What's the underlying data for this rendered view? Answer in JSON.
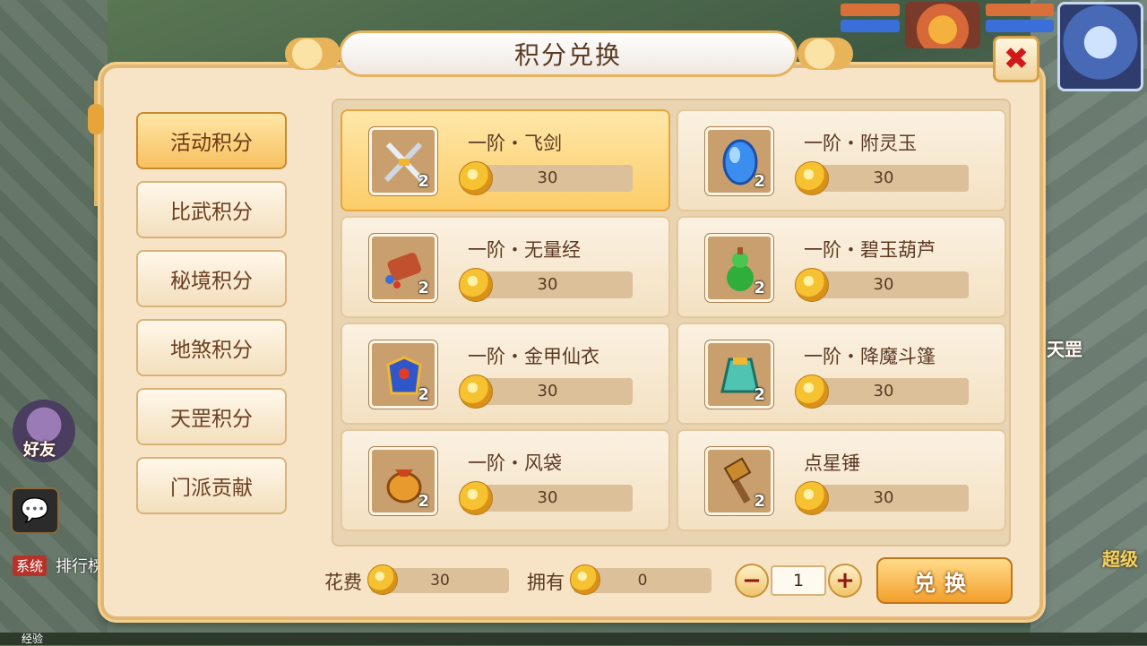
{
  "window": {
    "title": "积分兑换"
  },
  "background": {
    "friend_label": "好友",
    "system_tag": "系统",
    "rank_label": "排行榜",
    "exp_label": "经验",
    "right_text_1": "天罡",
    "right_text_2": "超级"
  },
  "tabs": [
    {
      "label": "活动积分",
      "active": true
    },
    {
      "label": "比武积分",
      "active": false
    },
    {
      "label": "秘境积分",
      "active": false
    },
    {
      "label": "地煞积分",
      "active": false
    },
    {
      "label": "天罡积分",
      "active": false
    },
    {
      "label": "门派贡献",
      "active": false
    }
  ],
  "items": [
    {
      "name": "一阶・飞剑",
      "count": "2",
      "price": "30",
      "icon": "sword-icon",
      "selected": true
    },
    {
      "name": "一阶・附灵玉",
      "count": "2",
      "price": "30",
      "icon": "jade-gem-icon",
      "selected": false
    },
    {
      "name": "一阶・无量经",
      "count": "2",
      "price": "30",
      "icon": "scroll-icon",
      "selected": false
    },
    {
      "name": "一阶・碧玉葫芦",
      "count": "2",
      "price": "30",
      "icon": "gourd-icon",
      "selected": false
    },
    {
      "name": "一阶・金甲仙衣",
      "count": "2",
      "price": "30",
      "icon": "armor-icon",
      "selected": false
    },
    {
      "name": "一阶・降魔斗篷",
      "count": "2",
      "price": "30",
      "icon": "cloak-icon",
      "selected": false
    },
    {
      "name": "一阶・风袋",
      "count": "2",
      "price": "30",
      "icon": "wind-bag-icon",
      "selected": false
    },
    {
      "name": "点星锤",
      "count": "2",
      "price": "30",
      "icon": "hammer-icon",
      "selected": false
    }
  ],
  "footer": {
    "cost_label": "花费",
    "cost_value": "30",
    "own_label": "拥有",
    "own_value": "0",
    "minus": "−",
    "plus": "+",
    "quantity": "1",
    "exchange_label": "兑换"
  },
  "close_symbol": "✖"
}
